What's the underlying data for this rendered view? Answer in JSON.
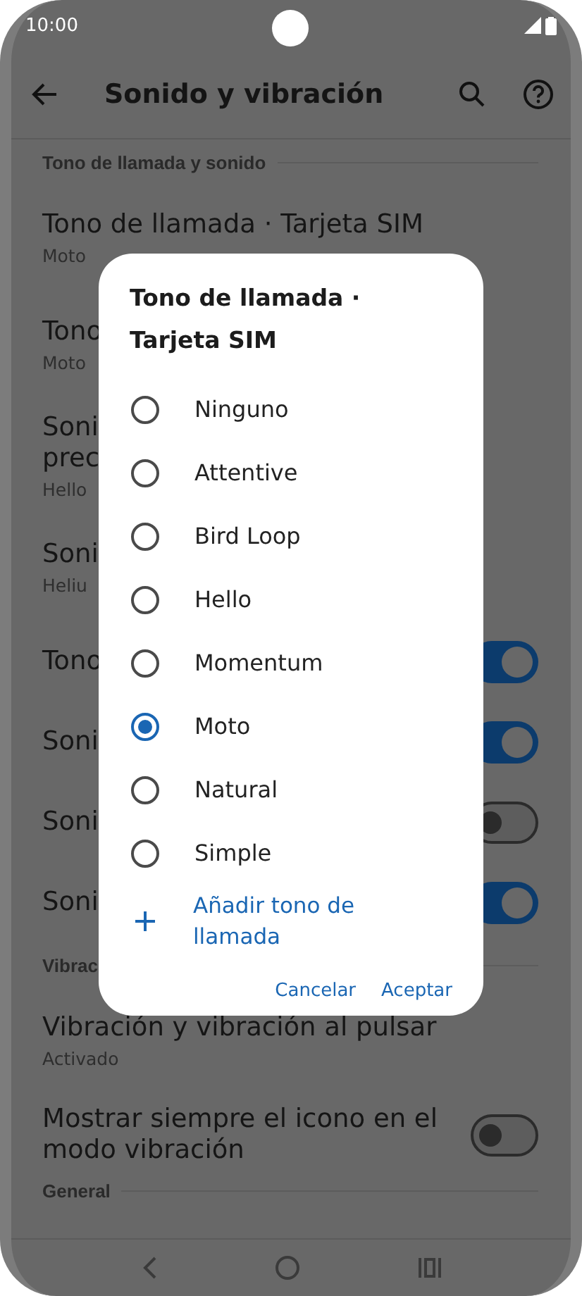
{
  "status_bar": {
    "time": "10:00"
  },
  "app_bar": {
    "title": "Sonido y vibración"
  },
  "settings": [
    {
      "kind": "header",
      "title": "Tono de llamada y sonido"
    },
    {
      "kind": "item",
      "title": "Tono de llamada · Tarjeta SIM",
      "subtitle": "Moto"
    },
    {
      "kind": "item",
      "title": "Tono",
      "subtitle": "Moto"
    },
    {
      "kind": "item",
      "title": "Soni\nprec",
      "subtitle": "Hello"
    },
    {
      "kind": "item",
      "title": "Soni",
      "subtitle": "Heliu"
    },
    {
      "kind": "toggle",
      "title": "Tono",
      "on": true
    },
    {
      "kind": "toggle",
      "title": "Soni",
      "on": true
    },
    {
      "kind": "toggle",
      "title": "Soni",
      "on": false
    },
    {
      "kind": "toggle",
      "title": "Soni",
      "on": true
    },
    {
      "kind": "header",
      "title": "Vibrac"
    },
    {
      "kind": "item",
      "title": "Vibración y vibración al pulsar",
      "subtitle": "Activado"
    },
    {
      "kind": "toggle",
      "title": "Mostrar siempre el icono en el modo vibración",
      "on": false
    },
    {
      "kind": "header",
      "title": "General"
    }
  ],
  "dialog": {
    "title": "Tono de llamada · Tarjeta SIM",
    "options": [
      {
        "label": "Ninguno",
        "selected": false
      },
      {
        "label": "Attentive",
        "selected": false
      },
      {
        "label": "Bird Loop",
        "selected": false
      },
      {
        "label": "Hello",
        "selected": false
      },
      {
        "label": "Momentum",
        "selected": false
      },
      {
        "label": "Moto",
        "selected": true
      },
      {
        "label": "Natural",
        "selected": false
      },
      {
        "label": "Simple",
        "selected": false
      }
    ],
    "add": "Añadir tono de llamada",
    "buttons": [
      "Cancelar",
      "Aceptar"
    ]
  }
}
